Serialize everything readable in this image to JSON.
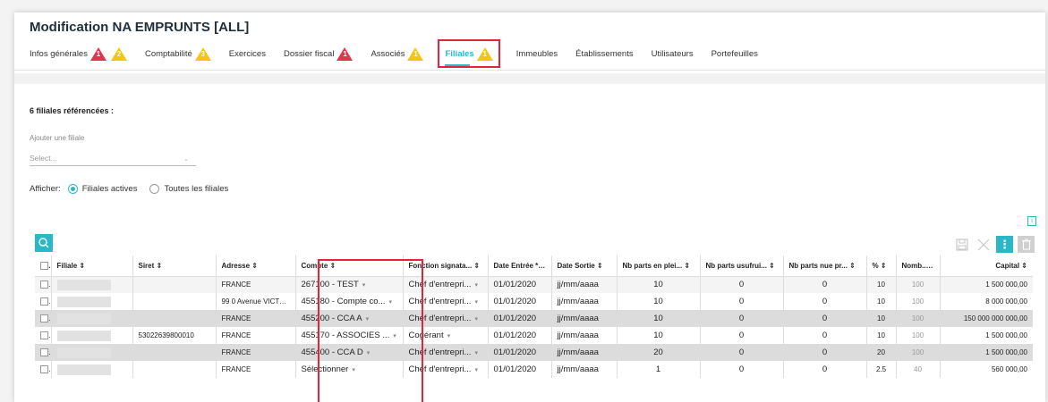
{
  "header": {
    "title": "Modification NA EMPRUNTS [ALL]"
  },
  "tabs": [
    {
      "label": "Infos générales",
      "badges": [
        {
          "color": "red",
          "n": "1"
        },
        {
          "color": "yellow",
          "n": "2"
        }
      ]
    },
    {
      "label": "Comptabilité",
      "badges": [
        {
          "color": "yellow",
          "n": "3"
        }
      ]
    },
    {
      "label": "Exercices",
      "badges": []
    },
    {
      "label": "Dossier fiscal",
      "badges": [
        {
          "color": "red",
          "n": "1"
        }
      ]
    },
    {
      "label": "Associés",
      "badges": [
        {
          "color": "yellow",
          "n": "1"
        }
      ]
    },
    {
      "label": "Filiales",
      "badges": [
        {
          "color": "yellow",
          "n": "1"
        }
      ],
      "active": true
    },
    {
      "label": "Immeubles",
      "badges": []
    },
    {
      "label": "Établissements",
      "badges": []
    },
    {
      "label": "Utilisateurs",
      "badges": []
    },
    {
      "label": "Portefeuilles",
      "badges": []
    }
  ],
  "summary": {
    "count_label": "6 filiales référencées :",
    "add_label": "Ajouter une filiale",
    "select_placeholder": "Select..."
  },
  "filter": {
    "label": "Afficher:",
    "option_active": "Filiales actives",
    "option_all": "Toutes les filiales"
  },
  "table": {
    "headers": [
      "Filiale ⇕",
      "Siret ⇕",
      "Adresse ⇕",
      "Compte ⇕",
      "Fonction signata... ⇕",
      "Date Entrée * ⇕",
      "Date Sortie ⇕",
      "Nb parts en plei... ⇕",
      "Nb parts usufrui... ⇕",
      "Nb parts nue pr... ⇕",
      "% ⇕",
      "Nomb... ⇕",
      "Capital ⇕"
    ],
    "rows": [
      {
        "siret": "",
        "adresse": "FRANCE",
        "compte": "267100 - TEST",
        "fonction": "Chef d'entrepri...",
        "date_entree": "01/01/2020",
        "date_sortie": "jj/mm/aaaa",
        "pp": "10",
        "us": "0",
        "np": "0",
        "pct": "10",
        "nomb": "100",
        "capital": "1 500 000,00"
      },
      {
        "siret": "",
        "adresse": "99 0 Avenue VICTO...",
        "compte": "455180 - Compte co...",
        "fonction": "Chef d'entrepri...",
        "date_entree": "01/01/2020",
        "date_sortie": "jj/mm/aaaa",
        "pp": "10",
        "us": "0",
        "np": "0",
        "pct": "10",
        "nomb": "100",
        "capital": "8 000 000,00"
      },
      {
        "siret": "",
        "adresse": "FRANCE",
        "compte": "455200 - CCA A",
        "fonction": "Chef d'entrepri...",
        "date_entree": "01/01/2020",
        "date_sortie": "jj/mm/aaaa",
        "pp": "10",
        "us": "0",
        "np": "0",
        "pct": "10",
        "nomb": "100",
        "capital": "150 000 000 000,00"
      },
      {
        "siret": "53022639800010",
        "adresse": "FRANCE",
        "compte": "455170 - ASSOCIES ...",
        "fonction": "Cogérant",
        "date_entree": "01/01/2020",
        "date_sortie": "jj/mm/aaaa",
        "pp": "10",
        "us": "0",
        "np": "0",
        "pct": "10",
        "nomb": "100",
        "capital": "1 500 000,00"
      },
      {
        "siret": "",
        "adresse": "FRANCE",
        "compte": "455400 - CCA D",
        "fonction": "Chef d'entrepri...",
        "date_entree": "01/01/2020",
        "date_sortie": "jj/mm/aaaa",
        "pp": "20",
        "us": "0",
        "np": "0",
        "pct": "20",
        "nomb": "100",
        "capital": "1 500 000,00"
      },
      {
        "siret": "",
        "adresse": "FRANCE",
        "compte": "Sélectionner",
        "fonction": "Chef d'entrepri...",
        "date_entree": "01/01/2020",
        "date_sortie": "jj/mm/aaaa",
        "pp": "1",
        "us": "0",
        "np": "0",
        "pct": "2.5",
        "nomb": "40",
        "capital": "560 000,00"
      }
    ]
  },
  "icons": {
    "search": "search-icon",
    "save": "save-icon",
    "close": "close-icon",
    "more": "more-vertical-icon",
    "delete": "trash-icon",
    "info": "info-icon"
  },
  "colors": {
    "accent": "#2bb8c6",
    "error": "#e0364b",
    "warning": "#f4c414",
    "highlight": "#e3243b"
  }
}
